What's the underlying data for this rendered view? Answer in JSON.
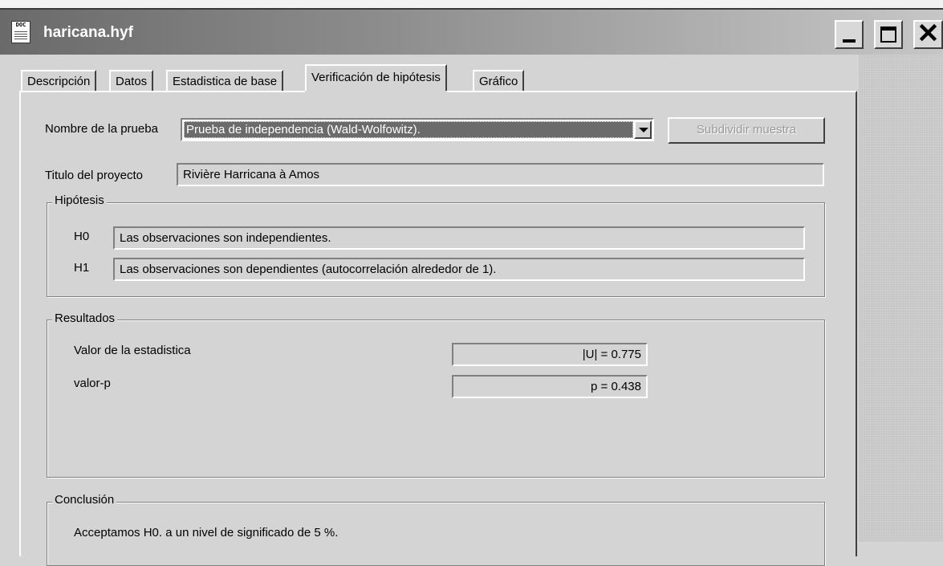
{
  "window": {
    "title": "haricana.hyf",
    "icon_label": "DOC",
    "icon": "document-icon",
    "minimize": "minimize-icon",
    "maximize": "maximize-icon",
    "close": "close-icon",
    "close_glyph": "✕"
  },
  "tabs": [
    {
      "label": "Descripción",
      "active": false
    },
    {
      "label": "Datos",
      "active": false
    },
    {
      "label": "Estadistica de base",
      "active": false
    },
    {
      "label": "Verificación de hipótesis",
      "active": true
    },
    {
      "label": "Gráfico",
      "active": false
    }
  ],
  "test": {
    "label": "Nombre de la prueba",
    "selected": "Prueba de independencia (Wald-Wolfowitz).",
    "subdivide_button": "Subdividir muestra"
  },
  "project": {
    "label": "Titulo del proyecto",
    "value": "Rivière Harricana à Amos"
  },
  "hypotheses": {
    "legend": "Hipótesis",
    "h0_label": "H0",
    "h0_value": "Las observaciones son independientes.",
    "h1_label": "H1",
    "h1_value": "Las observaciones son dependientes (autocorrelación alrededor de 1)."
  },
  "results": {
    "legend": "Resultados",
    "statistic_label": "Valor de la estadistica",
    "statistic_value": "|U| =  0.775",
    "pvalue_label": "valor-p",
    "pvalue_value": "p =  0.438"
  },
  "conclusion": {
    "legend": "Conclusión",
    "text": "Acceptamos H0. a un nivel de significado de 5 %."
  },
  "colors": {
    "title_bar": "#7a7a7a",
    "selection": "#6b6b6b",
    "face": "#d4d4d4"
  }
}
